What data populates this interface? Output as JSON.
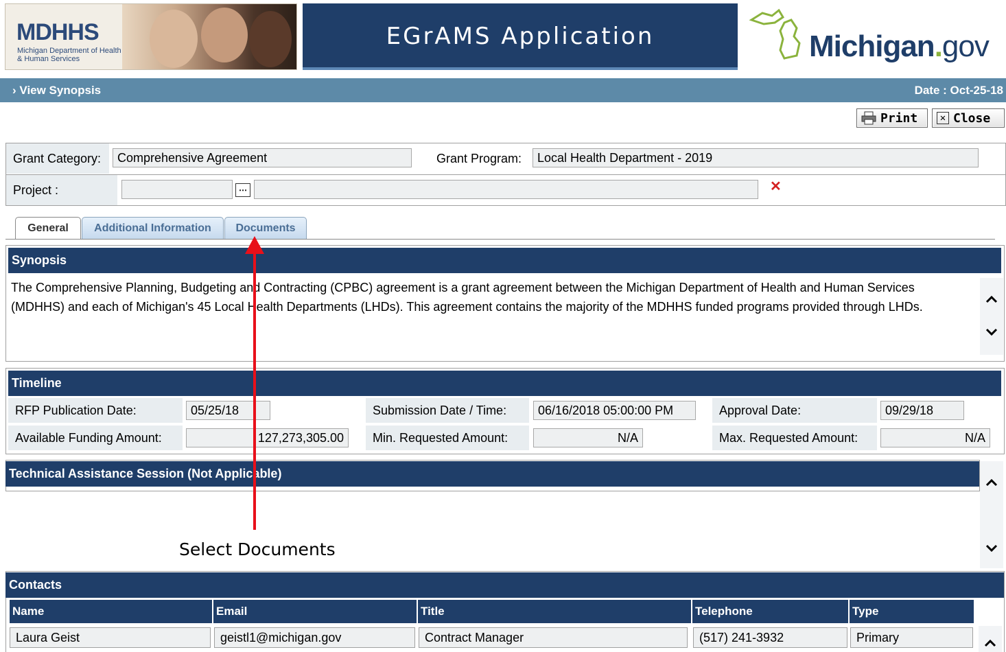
{
  "header": {
    "agency_logo_text": "MDHHS",
    "agency_logo_sub": "Michigan Department of Health & Human Services",
    "app_title": "EGrAMS Application",
    "state_logo": {
      "main": "Michigan",
      "dot": ".",
      "suffix": "gov"
    }
  },
  "titlebar": {
    "page_title": "View Synopsis",
    "date": "Date : Oct-25-18"
  },
  "toolbar": {
    "print_label": "Print",
    "close_label": "Close"
  },
  "grant": {
    "category_label": "Grant Category:",
    "category_value": "Comprehensive Agreement",
    "program_label": "Grant Program:",
    "program_value": "Local Health Department - 2019",
    "project_label": "Project :",
    "project_code": "",
    "project_name": ""
  },
  "tabs": [
    {
      "label": "General",
      "active": true
    },
    {
      "label": "Additional Information",
      "active": false
    },
    {
      "label": "Documents",
      "active": false
    }
  ],
  "synopsis": {
    "heading": "Synopsis",
    "text": "The Comprehensive Planning, Budgeting and Contracting (CPBC) agreement is a grant agreement between the Michigan Department of Health and Human Services (MDHHS) and each of Michigan's 45 Local Health Departments (LHDs). This agreement contains the majority of the MDHHS funded programs provided through LHDs."
  },
  "timeline": {
    "heading": "Timeline",
    "rfp_label": "RFP Publication Date:",
    "rfp_value": "05/25/18",
    "submission_label": "Submission Date / Time:",
    "submission_value": "06/16/2018 05:00:00 PM",
    "approval_label": "Approval Date:",
    "approval_value": "09/29/18",
    "funding_label": "Available Funding Amount:",
    "funding_value": "127,273,305.00",
    "min_label": "Min. Requested Amount:",
    "min_value": "N/A",
    "max_label": "Max. Requested Amount:",
    "max_value": "N/A"
  },
  "tech_session": {
    "heading": "Technical Assistance Session (Not Applicable)"
  },
  "contacts": {
    "heading": "Contacts",
    "columns": [
      "Name",
      "Email",
      "Title",
      "Telephone",
      "Type"
    ],
    "rows": [
      [
        "Laura Geist",
        "geistl1@michigan.gov",
        "Contract Manager",
        "(517) 241-3932",
        "Primary"
      ]
    ]
  },
  "annotation": {
    "text": "Select Documents",
    "color": "#e8101a"
  },
  "colors": {
    "section_header": "#1f3e69",
    "titlebar": "#5d8aa8",
    "field_bg": "#eef0f1"
  }
}
